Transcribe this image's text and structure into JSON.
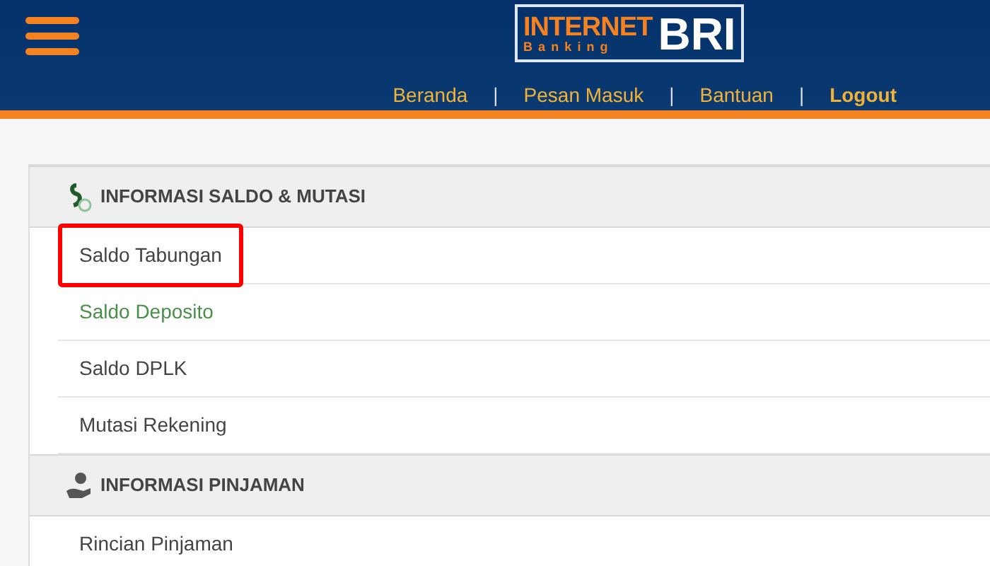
{
  "logo": {
    "line1": "INTERNET",
    "line2": "Banking",
    "brand": "BRI"
  },
  "nav": [
    {
      "label": "Beranda",
      "bold": false
    },
    {
      "label": "Pesan Masuk",
      "bold": false
    },
    {
      "label": "Bantuan",
      "bold": false
    },
    {
      "label": "Logout",
      "bold": true
    }
  ],
  "nav_separator": "|",
  "sections": [
    {
      "title": "INFORMASI SALDO & MUTASI",
      "items": [
        {
          "label": "Saldo Tabungan",
          "selected": false,
          "highlighted": true
        },
        {
          "label": "Saldo Deposito",
          "selected": true,
          "highlighted": false
        },
        {
          "label": "Saldo DPLK",
          "selected": false,
          "highlighted": false
        },
        {
          "label": "Mutasi Rekening",
          "selected": false,
          "highlighted": false
        }
      ]
    },
    {
      "title": "INFORMASI PINJAMAN",
      "items": [
        {
          "label": "Rincian Pinjaman",
          "selected": false,
          "highlighted": false
        }
      ]
    }
  ]
}
